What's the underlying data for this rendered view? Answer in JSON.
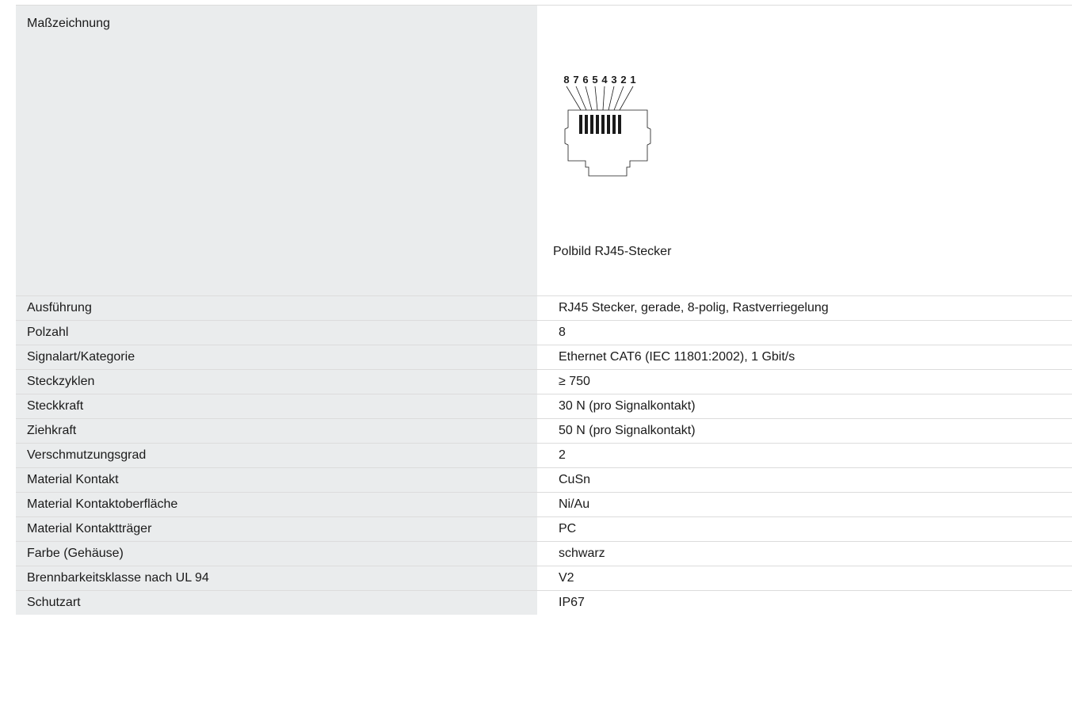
{
  "drawing_section": {
    "label": "Maßzeichnung",
    "pin_numbers": [
      "8",
      "7",
      "6",
      "5",
      "4",
      "3",
      "2",
      "1"
    ],
    "caption": "Polbild RJ45-Stecker"
  },
  "specs": [
    {
      "label": "Ausführung",
      "value": "RJ45 Stecker, gerade, 8-polig, Rastverriegelung"
    },
    {
      "label": "Polzahl",
      "value": "8"
    },
    {
      "label": "Signalart/Kategorie",
      "value": "Ethernet CAT6 (IEC 11801:2002), 1 Gbit/s"
    },
    {
      "label": "Steckzyklen",
      "value": "≥ 750"
    },
    {
      "label": "Steckkraft",
      "value": "30 N (pro Signalkontakt)"
    },
    {
      "label": "Ziehkraft",
      "value": "50 N (pro Signalkontakt)"
    },
    {
      "label": "Verschmutzungsgrad",
      "value": "2"
    },
    {
      "label": "Material Kontakt",
      "value": "CuSn"
    },
    {
      "label": "Material Kontaktoberfläche",
      "value": "Ni/Au"
    },
    {
      "label": "Material Kontaktträger",
      "value": "PC"
    },
    {
      "label": "Farbe (Gehäuse)",
      "value": "schwarz"
    },
    {
      "label": "Brennbarkeitsklasse nach UL 94",
      "value": "V2"
    },
    {
      "label": "Schutzart",
      "value": "IP67"
    }
  ]
}
